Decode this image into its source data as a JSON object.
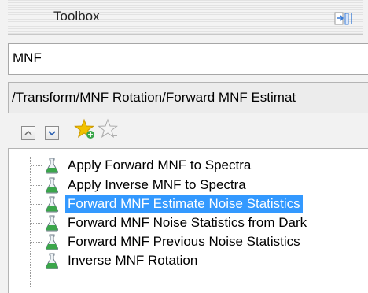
{
  "toolbox": {
    "title": "Toolbox",
    "dock_icon": "dock-icon"
  },
  "search": {
    "value": "MNF"
  },
  "path": {
    "text": "/Transform/MNF Rotation/Forward MNF Estimat"
  },
  "toolbar": {
    "collapse_icon": "chevron-up-icon",
    "expand_icon": "chevron-down-icon",
    "add_favorite_icon": "add-favorite-star-icon",
    "remove_favorite_icon": "remove-favorite-star-icon"
  },
  "tree": {
    "items": [
      {
        "label": "Apply Forward MNF to Spectra",
        "icon": "flask-icon",
        "selected": false
      },
      {
        "label": "Apply Inverse MNF to Spectra",
        "icon": "flask-icon",
        "selected": false
      },
      {
        "label": "Forward MNF Estimate Noise Statistics",
        "icon": "flask-icon",
        "selected": true
      },
      {
        "label": "Forward MNF Noise Statistics from Dark",
        "icon": "flask-icon",
        "selected": false
      },
      {
        "label": "Forward MNF Previous Noise Statistics",
        "icon": "flask-icon",
        "selected": false
      },
      {
        "label": "Inverse MNF Rotation",
        "icon": "flask-icon",
        "selected": false
      }
    ]
  },
  "colors": {
    "selection": "#3399ff",
    "star_gold": "#f2c200",
    "flask_green": "#3aa64a"
  }
}
